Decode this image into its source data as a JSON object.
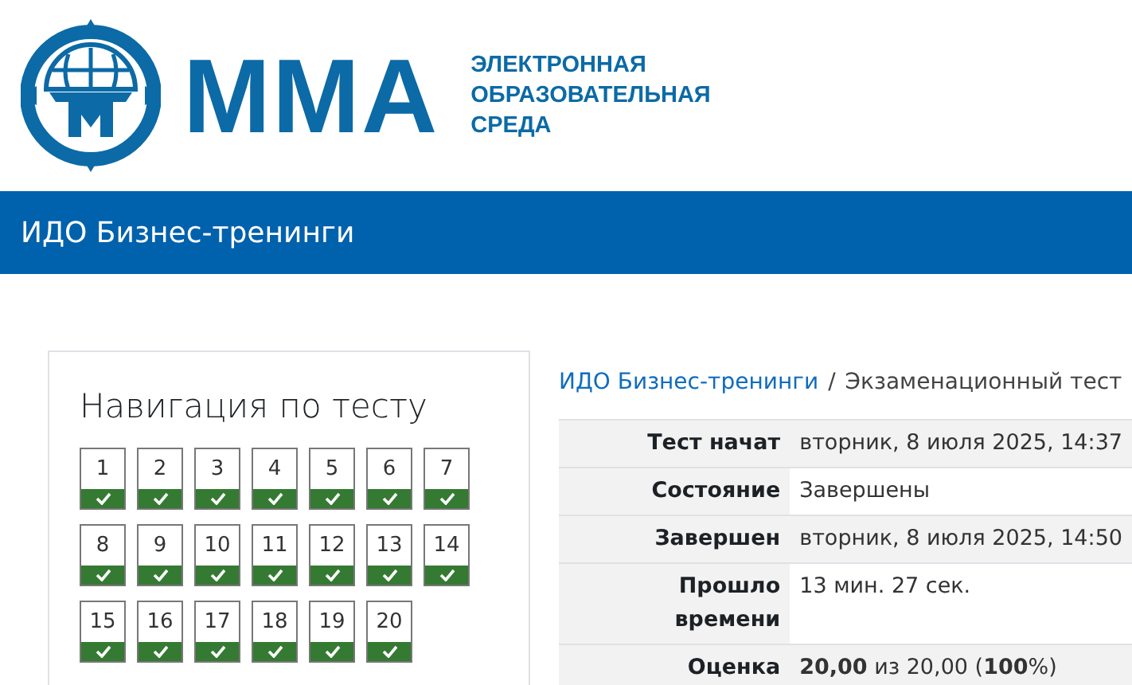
{
  "logo": {
    "brand": "ММА",
    "tagline_lines": [
      "ЭЛЕКТРОННАЯ",
      "ОБРАЗОВАТЕЛЬНАЯ",
      "СРЕДА"
    ]
  },
  "course_bar": {
    "title": "ИДО Бизнес-тренинги"
  },
  "quiz_navigation": {
    "title": "Навигация по тесту",
    "questions": [
      {
        "number": "1",
        "answered": true
      },
      {
        "number": "2",
        "answered": true
      },
      {
        "number": "3",
        "answered": true
      },
      {
        "number": "4",
        "answered": true
      },
      {
        "number": "5",
        "answered": true
      },
      {
        "number": "6",
        "answered": true
      },
      {
        "number": "7",
        "answered": true
      },
      {
        "number": "8",
        "answered": true
      },
      {
        "number": "9",
        "answered": true
      },
      {
        "number": "10",
        "answered": true
      },
      {
        "number": "11",
        "answered": true
      },
      {
        "number": "12",
        "answered": true
      },
      {
        "number": "13",
        "answered": true
      },
      {
        "number": "14",
        "answered": true
      },
      {
        "number": "15",
        "answered": true
      },
      {
        "number": "16",
        "answered": true
      },
      {
        "number": "17",
        "answered": true
      },
      {
        "number": "18",
        "answered": true
      },
      {
        "number": "19",
        "answered": true
      },
      {
        "number": "20",
        "answered": true
      }
    ]
  },
  "breadcrumb": [
    {
      "label": "ИДО Бизнес-тренинги",
      "kind": "link"
    },
    {
      "label": "Экзаменационный тест",
      "kind": "current"
    }
  ],
  "breadcrumb_separator": "/",
  "summary": [
    {
      "label": "Тест начат",
      "value": "вторник, 8 июля 2025, 14:37"
    },
    {
      "label": "Состояние",
      "value": "Завершены"
    },
    {
      "label": "Завершен",
      "value": "вторник, 8 июля 2025, 14:50"
    },
    {
      "label": "Прошло времени",
      "value": "13 мин. 27 сек."
    },
    {
      "label": "Оценка",
      "value": "**20,00** из 20,00 (**100**%)"
    }
  ]
}
